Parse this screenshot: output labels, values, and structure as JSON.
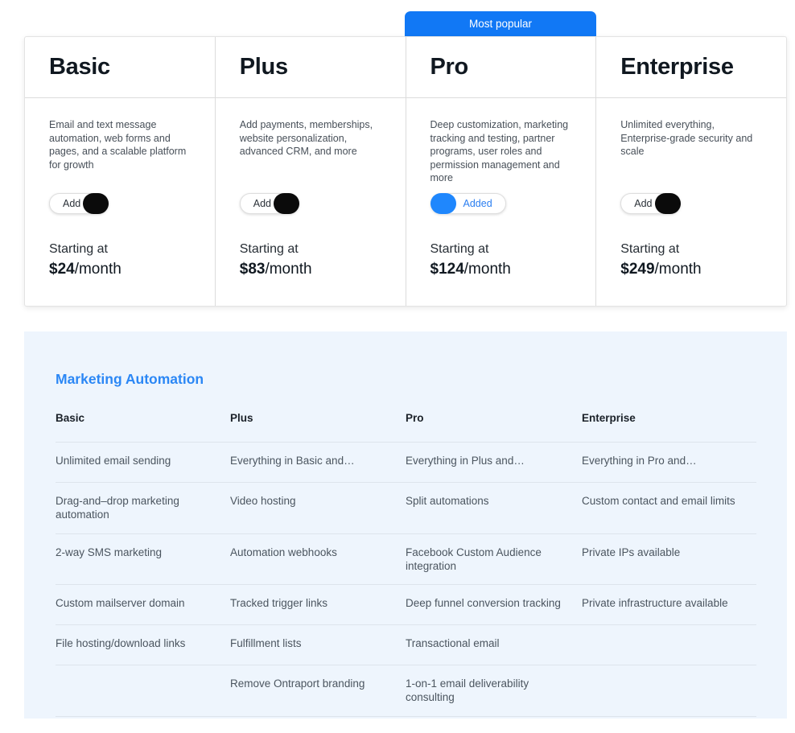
{
  "badge": {
    "label": "Most popular"
  },
  "plans": [
    {
      "name": "Basic",
      "description": "Email and text message automation, web forms and pages, and a scalable platform for growth",
      "toggle": {
        "label": "Add",
        "state": "off"
      },
      "price_pre": "Starting at",
      "price_amount": "$24",
      "price_period": "/month"
    },
    {
      "name": "Plus",
      "description": "Add payments, memberships, website personalization, advanced CRM, and more",
      "toggle": {
        "label": "Add",
        "state": "off"
      },
      "price_pre": "Starting at",
      "price_amount": "$83",
      "price_period": "/month"
    },
    {
      "name": "Pro",
      "description": "Deep customization, marketing tracking and testing, partner programs, user roles and permission management and more",
      "toggle": {
        "label": "Added",
        "state": "on"
      },
      "price_pre": "Starting at",
      "price_amount": "$124",
      "price_period": "/month"
    },
    {
      "name": "Enterprise",
      "description": "Unlimited everything, Enterprise-grade security and scale",
      "toggle": {
        "label": "Add",
        "state": "off"
      },
      "price_pre": "Starting at",
      "price_amount": "$249",
      "price_period": "/month"
    }
  ],
  "feature_section": {
    "title": "Marketing Automation",
    "columns": [
      "Basic",
      "Plus",
      "Pro",
      "Enterprise"
    ],
    "rows": [
      [
        "Unlimited email sending",
        "Everything in Basic and…",
        "Everything in Plus and…",
        "Everything in Pro and…"
      ],
      [
        "Drag-and–drop marketing automation",
        "Video hosting",
        "Split automations",
        "Custom contact and email limits"
      ],
      [
        "2-way SMS marketing",
        "Automation webhooks",
        "Facebook Custom Audience integration",
        "Private IPs available"
      ],
      [
        "Custom mailserver domain",
        "Tracked trigger links",
        "Deep funnel conversion tracking",
        "Private infrastructure available"
      ],
      [
        "File hosting/download links",
        "Fulfillment lists",
        "Transactional email",
        ""
      ],
      [
        "",
        "Remove Ontraport branding",
        "1-on-1 email deliverability consulting",
        ""
      ]
    ]
  },
  "colors": {
    "accent_blue": "#1178f5",
    "title_blue": "#2b87f5",
    "panel_bg": "#eef5fd",
    "toggle_on": "#1f87fd",
    "toggle_off_knob": "#0b0b0b"
  }
}
